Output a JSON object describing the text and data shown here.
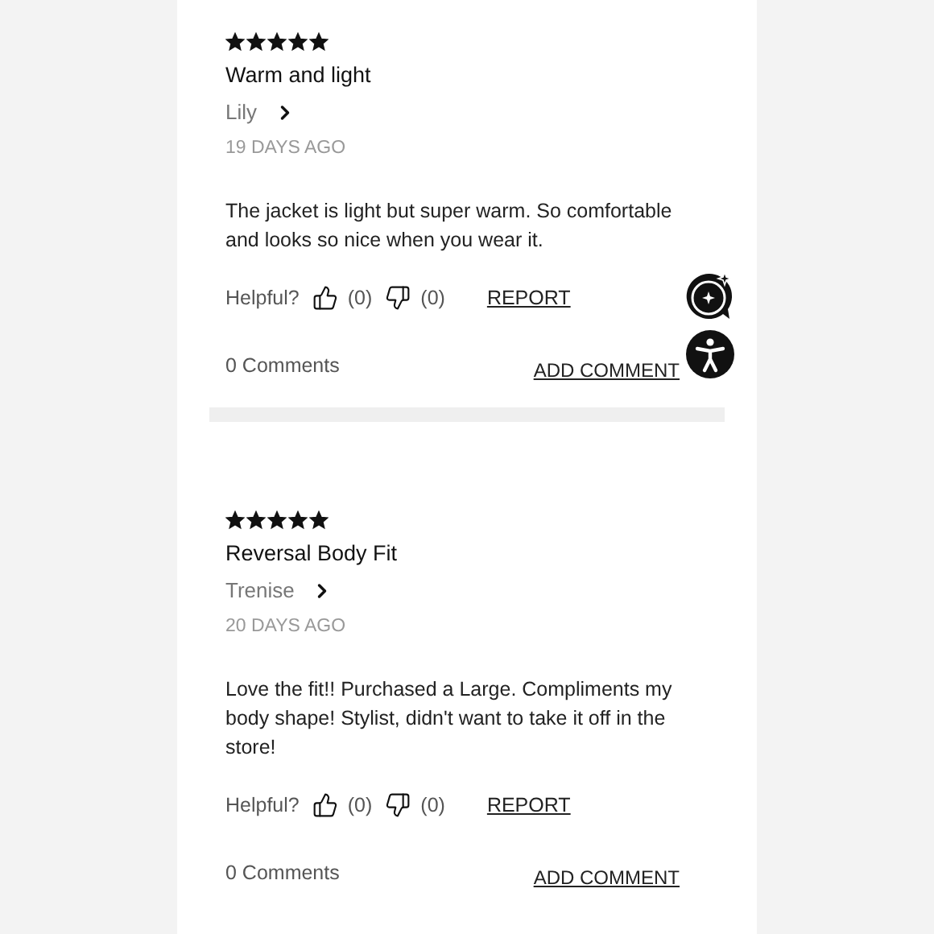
{
  "reviews": [
    {
      "stars": 5,
      "title": "Warm and light",
      "author": "Lily",
      "date": "19 DAYS AGO",
      "body": "The jacket is light but super warm. So comfortable and looks so nice when you wear it.",
      "helpful_label": "Helpful?",
      "up_count": "(0)",
      "down_count": "(0)",
      "report": "REPORT",
      "comments": "0 Comments",
      "add_comment": "ADD COMMENT"
    },
    {
      "stars": 5,
      "title": "Reversal Body Fit",
      "author": "Trenise",
      "date": "20 DAYS AGO",
      "body": "Love the fit!! Purchased a Large. Compliments my body shape! Stylist, didn't want to take it off in the store!",
      "helpful_label": "Helpful?",
      "up_count": "(0)",
      "down_count": "(0)",
      "report": "REPORT",
      "comments": "0 Comments",
      "add_comment": "ADD COMMENT"
    }
  ]
}
